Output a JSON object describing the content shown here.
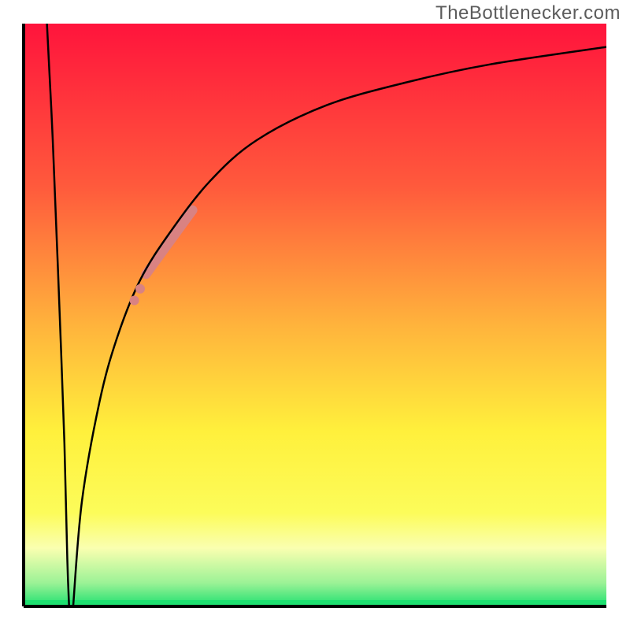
{
  "watermark": "TheBottlenecker.com",
  "chart_data": {
    "type": "line",
    "title": "",
    "xlabel": "",
    "ylabel": "",
    "xlim": [
      0,
      100
    ],
    "ylim": [
      0,
      100
    ],
    "gradient_stops": [
      {
        "offset": 0.0,
        "color": "#ff143c"
      },
      {
        "offset": 0.28,
        "color": "#ff5a3c"
      },
      {
        "offset": 0.52,
        "color": "#ffb43c"
      },
      {
        "offset": 0.7,
        "color": "#fff03c"
      },
      {
        "offset": 0.84,
        "color": "#fcfc5a"
      },
      {
        "offset": 0.9,
        "color": "#faffb0"
      },
      {
        "offset": 0.96,
        "color": "#9bf296"
      },
      {
        "offset": 1.0,
        "color": "#1ee070"
      }
    ],
    "series": [
      {
        "name": "left-branch",
        "x": [
          4.0,
          5.0,
          6.0,
          7.0,
          7.5,
          7.8
        ],
        "y": [
          100,
          80,
          55,
          28,
          8,
          0
        ]
      },
      {
        "name": "right-branch",
        "x": [
          8.5,
          10,
          13,
          16,
          20,
          25,
          32,
          40,
          52,
          66,
          80,
          100
        ],
        "y": [
          0,
          18,
          35,
          46,
          56,
          64,
          73,
          80,
          86,
          90,
          93,
          96
        ]
      }
    ],
    "annotations": [
      {
        "name": "highlight-upper",
        "type": "segment",
        "color": "#d98282",
        "width": 12,
        "x": [
          21,
          29
        ],
        "y": [
          57,
          68
        ]
      },
      {
        "name": "highlight-lower",
        "type": "dots",
        "color": "#d98282",
        "r": 6,
        "points": [
          {
            "x": 20.0,
            "y": 54.5
          },
          {
            "x": 19.0,
            "y": 52.5
          }
        ]
      }
    ]
  }
}
